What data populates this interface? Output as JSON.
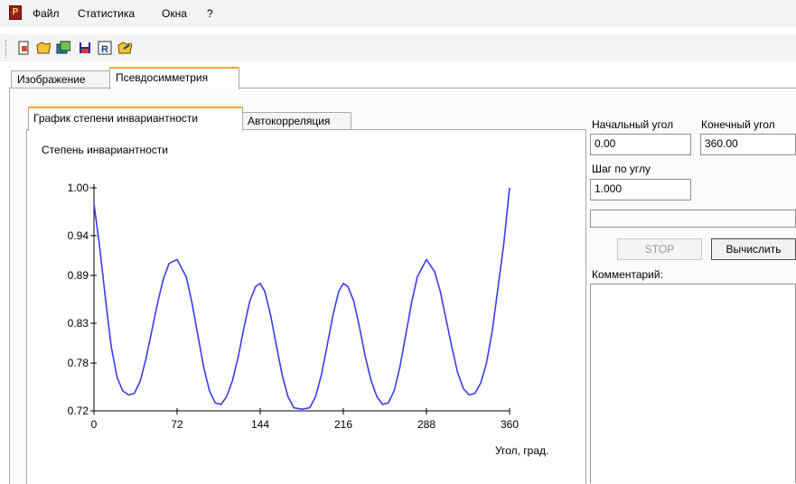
{
  "menu": {
    "items": [
      "Файл",
      "Статистика",
      "Окна",
      "?"
    ]
  },
  "toolbar": {
    "icons": [
      "new-document-icon",
      "open-folder-icon",
      "images-icon",
      "save-disk-icon",
      "report-r-icon",
      "export-folder-icon"
    ]
  },
  "tabs": {
    "main": [
      "Изображение",
      "Псевдосимметрия"
    ],
    "active_main": "Псевдосимметрия",
    "sub": [
      "График степени инвариантности",
      "Автокорреляция"
    ],
    "active_sub": "График степени инвариантности"
  },
  "params": {
    "start_angle_label": "Начальный угол",
    "start_angle_value": "0.00",
    "end_angle_label": "Конечный угол",
    "end_angle_value": "360.00",
    "step_label": "Шаг по углу",
    "step_value": "1.000",
    "progress": 0
  },
  "buttons": {
    "stop": "STOP",
    "calculate": "Вычислить"
  },
  "comment": {
    "label": "Комментарий:",
    "value": ""
  },
  "colors": {
    "accent_tab": "#f1a634",
    "curve": "#3b3bf2"
  },
  "chart_data": {
    "type": "line",
    "title": "Степень инвариантности",
    "xlabel": "Угол, град.",
    "ylabel": "",
    "xlim": [
      0,
      360
    ],
    "ylim": [
      0.72,
      1.0
    ],
    "x_ticks": [
      "0",
      "72",
      "144",
      "216",
      "288",
      "360"
    ],
    "y_ticks": [
      "1.00",
      "0.94",
      "0.89",
      "0.83",
      "0.78",
      "0.72"
    ],
    "series": [
      {
        "x": [
          0,
          5,
          10,
          15,
          20,
          25,
          30,
          35,
          40,
          45,
          50,
          55,
          60,
          65,
          72,
          80,
          85,
          90,
          95,
          100,
          105,
          110,
          115,
          120,
          125,
          130,
          135,
          140,
          144,
          148,
          153,
          158,
          163,
          168,
          173,
          180,
          187,
          192,
          197,
          202,
          207,
          212,
          216,
          220,
          225,
          230,
          235,
          240,
          245,
          250,
          255,
          260,
          265,
          270,
          275,
          280,
          288,
          295,
          300,
          305,
          310,
          315,
          320,
          325,
          330,
          335,
          340,
          345,
          350,
          355,
          360
        ],
        "y": [
          0.98,
          0.925,
          0.86,
          0.8,
          0.762,
          0.745,
          0.74,
          0.742,
          0.757,
          0.785,
          0.82,
          0.855,
          0.885,
          0.905,
          0.91,
          0.888,
          0.855,
          0.815,
          0.775,
          0.745,
          0.73,
          0.728,
          0.738,
          0.758,
          0.788,
          0.825,
          0.858,
          0.876,
          0.88,
          0.87,
          0.84,
          0.802,
          0.765,
          0.738,
          0.724,
          0.722,
          0.724,
          0.738,
          0.765,
          0.802,
          0.84,
          0.87,
          0.88,
          0.876,
          0.858,
          0.825,
          0.788,
          0.758,
          0.738,
          0.728,
          0.73,
          0.745,
          0.775,
          0.815,
          0.855,
          0.888,
          0.91,
          0.895,
          0.87,
          0.835,
          0.8,
          0.768,
          0.748,
          0.74,
          0.742,
          0.755,
          0.78,
          0.82,
          0.875,
          0.93,
          1.0
        ]
      }
    ]
  }
}
